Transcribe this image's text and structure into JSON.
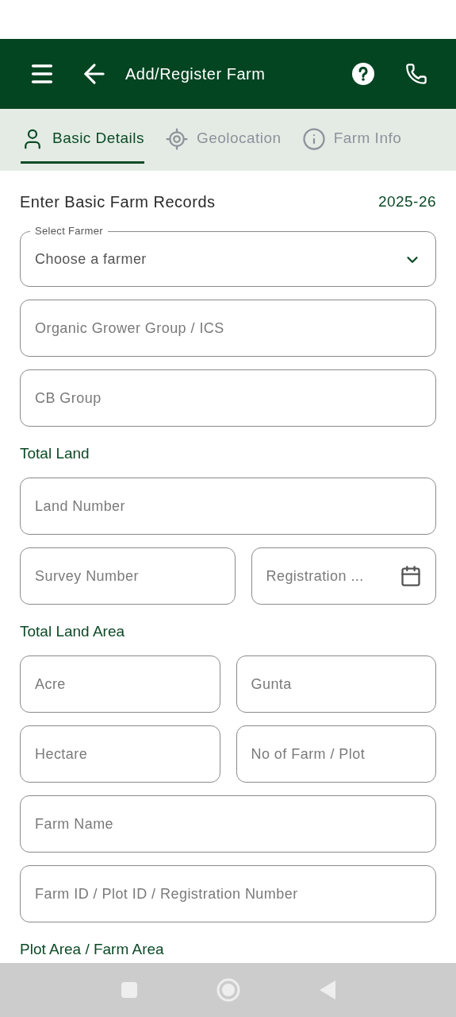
{
  "header": {
    "title": "Add/Register Farm"
  },
  "tabs": [
    {
      "label": "Basic Details",
      "selected": true
    },
    {
      "label": "Geolocation",
      "selected": false
    },
    {
      "label": "Farm Info",
      "selected": false
    }
  ],
  "form": {
    "heading": "Enter Basic Farm Records",
    "year": "2025-26",
    "items": [
      {
        "kind": "select",
        "label": "Select Farmer",
        "value": "Choose a farmer"
      },
      {
        "kind": "fields",
        "fields": [
          {
            "kind": "text",
            "placeholder": "Organic Grower Group / ICS"
          }
        ]
      },
      {
        "kind": "fields",
        "fields": [
          {
            "kind": "text",
            "placeholder": "CB Group"
          }
        ]
      },
      {
        "kind": "heading",
        "text": "Total Land"
      },
      {
        "kind": "fields",
        "fields": [
          {
            "kind": "text",
            "placeholder": "Land Number"
          }
        ]
      },
      {
        "kind": "fields",
        "fields": [
          {
            "kind": "text",
            "placeholder": "Survey Number"
          },
          {
            "kind": "date",
            "placeholder": "Registration ..."
          }
        ]
      },
      {
        "kind": "heading",
        "text": "Total Land Area"
      },
      {
        "kind": "fields",
        "fields": [
          {
            "kind": "text",
            "placeholder": "Acre"
          },
          {
            "kind": "text",
            "placeholder": "Gunta"
          }
        ]
      },
      {
        "kind": "fields",
        "fields": [
          {
            "kind": "text",
            "placeholder": "Hectare"
          },
          {
            "kind": "text",
            "placeholder": "No of Farm / Plot"
          }
        ]
      },
      {
        "kind": "fields",
        "fields": [
          {
            "kind": "text",
            "placeholder": "Farm Name"
          }
        ]
      },
      {
        "kind": "fields",
        "fields": [
          {
            "kind": "text",
            "placeholder": "Farm ID / Plot ID / Registration Number"
          }
        ]
      },
      {
        "kind": "heading",
        "text": "Plot Area / Farm Area"
      }
    ]
  }
}
